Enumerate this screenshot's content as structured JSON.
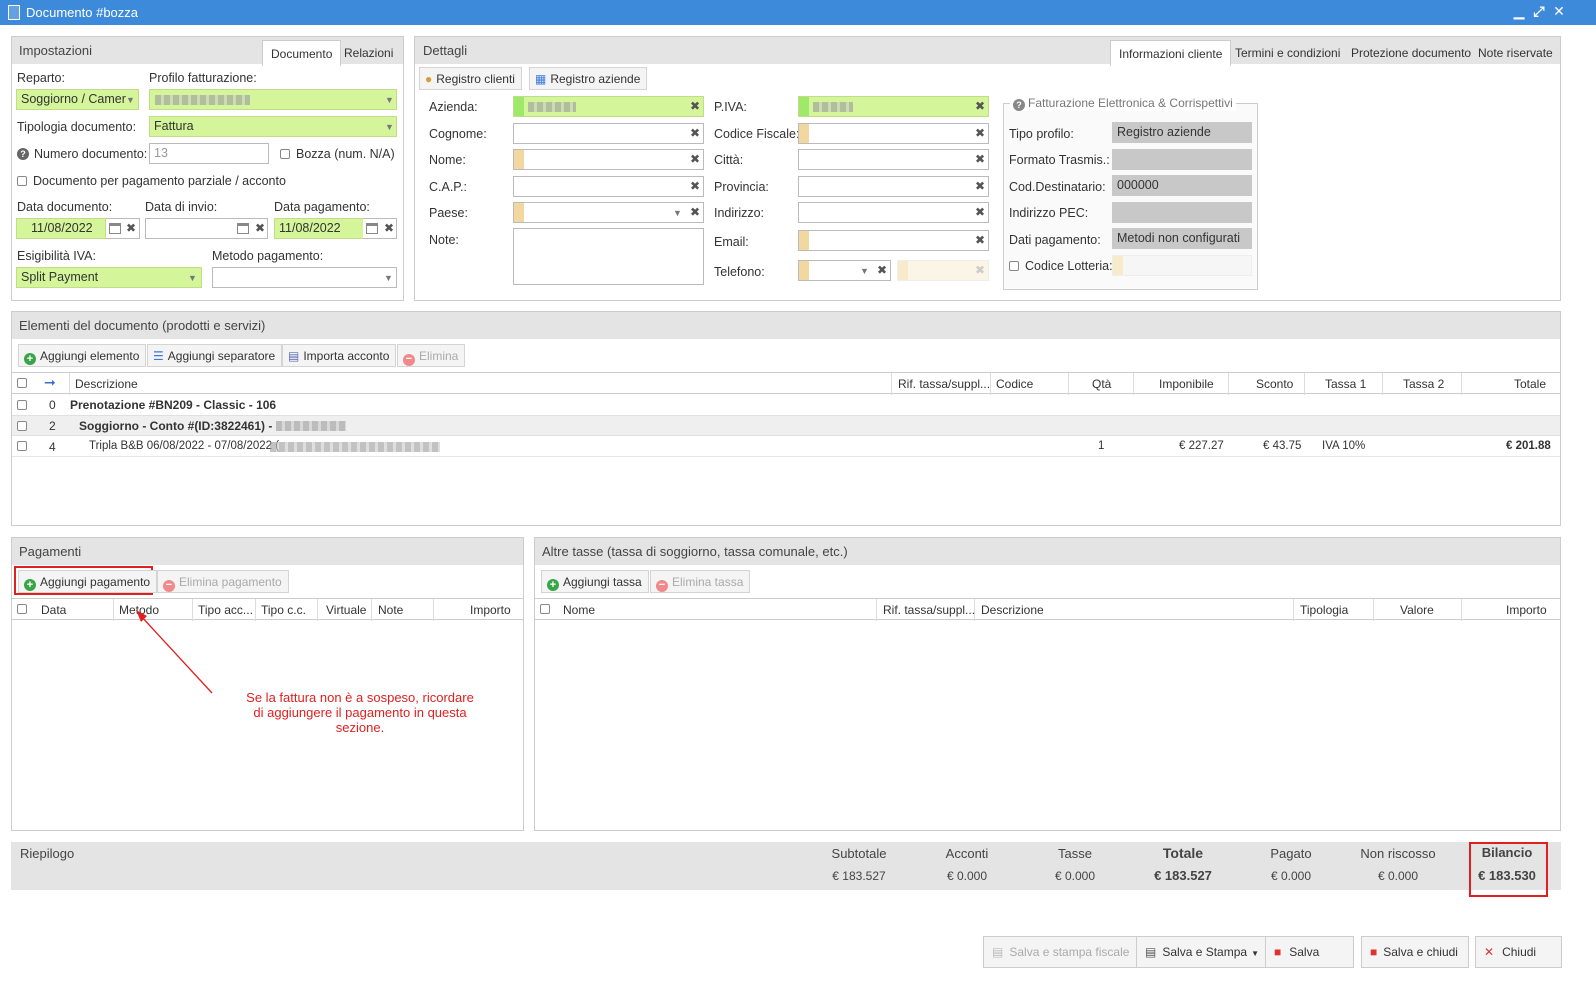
{
  "window": {
    "title": "Documento #bozza"
  },
  "settings": {
    "title": "Impostazioni",
    "tabs": [
      "Documento",
      "Relazioni"
    ],
    "reparto_label": "Reparto:",
    "reparto_value": "Soggiorno / Camer",
    "profilo_label": "Profilo fatturazione:",
    "tipologia_label": "Tipologia documento:",
    "tipologia_value": "Fattura",
    "numero_label": "Numero documento:",
    "numero_placeholder": "13",
    "bozza_label": "Bozza (num. N/A)",
    "parziale_label": "Documento per pagamento parziale / acconto",
    "data_doc_label": "Data documento:",
    "data_doc_value": "11/08/2022",
    "data_invio_label": "Data di invio:",
    "data_pag_label": "Data pagamento:",
    "data_pag_value": "11/08/2022",
    "esigibilita_label": "Esigibilità IVA:",
    "esigibilita_value": "Split Payment",
    "metodo_label": "Metodo pagamento:"
  },
  "details": {
    "title": "Dettagli",
    "tabs": [
      "Informazioni cliente",
      "Termini e condizioni",
      "Protezione documento",
      "Note riservate"
    ],
    "btn_registro_clienti": "Registro clienti",
    "btn_registro_aziende": "Registro aziende",
    "fields_left": [
      "Azienda:",
      "Cognome:",
      "Nome:",
      "C.A.P.:",
      "Paese:",
      "Note:"
    ],
    "fields_mid": [
      "P.IVA:",
      "Codice Fiscale:",
      "Città:",
      "Provincia:",
      "Indirizzo:",
      "Email:",
      "Telefono:"
    ],
    "fe_title": "Fatturazione Elettronica & Corrispettivi",
    "fe_fields": [
      {
        "label": "Tipo profilo:",
        "value": "Registro aziende"
      },
      {
        "label": "Formato Trasmis.:",
        "value": ""
      },
      {
        "label": "Cod.Destinatario:",
        "value": "000000"
      },
      {
        "label": "Indirizzo PEC:",
        "value": ""
      },
      {
        "label": "Dati pagamento:",
        "value": "Metodi non configurati"
      }
    ],
    "lotteria_label": "Codice Lotteria:"
  },
  "elements": {
    "title": "Elementi del documento (prodotti e servizi)",
    "btn_add": "Aggiungi elemento",
    "btn_sep": "Aggiungi separatore",
    "btn_import": "Importa acconto",
    "btn_del": "Elimina",
    "columns": [
      "Descrizione",
      "Rif. tassa/suppl...",
      "Codice",
      "Qtà",
      "Imponibile",
      "Sconto",
      "Tassa 1",
      "Tassa 2",
      "Totale"
    ],
    "rows": [
      {
        "idx": "0",
        "desc": "Prenotazione #BN209 - Classic - 106",
        "qty": "",
        "imp": "",
        "sconto": "",
        "tassa1": "",
        "totale": ""
      },
      {
        "idx": "2",
        "desc": "Soggiorno - Conto #(ID:3822461) -",
        "qty": "",
        "imp": "",
        "sconto": "",
        "tassa1": "",
        "totale": ""
      },
      {
        "idx": "4",
        "desc": "Tripla B&B 06/08/2022 - 07/08/2022 (",
        "qty": "1",
        "imp": "€ 227.27",
        "sconto": "€ 43.75",
        "tassa1": "IVA 10%",
        "totale": "€ 201.88"
      }
    ]
  },
  "payments": {
    "title": "Pagamenti",
    "btn_add": "Aggiungi pagamento",
    "btn_del": "Elimina pagamento",
    "columns": [
      "Data",
      "Metodo",
      "Tipo acc...",
      "Tipo c.c.",
      "Virtuale",
      "Note",
      "Importo"
    ],
    "annotation": [
      "Se la fattura non è a sospeso, ricordare",
      "di aggiungere il pagamento in questa",
      "sezione."
    ]
  },
  "taxes": {
    "title": "Altre tasse (tassa di soggiorno, tassa comunale, etc.)",
    "btn_add": "Aggiungi tassa",
    "btn_del": "Elimina tassa",
    "columns": [
      "Nome",
      "Rif. tassa/suppl...",
      "Descrizione",
      "Tipologia",
      "Valore",
      "Importo"
    ]
  },
  "summary": {
    "title": "Riepilogo",
    "items": [
      {
        "label": "Subtotale",
        "value": "€ 183.527"
      },
      {
        "label": "Acconti",
        "value": "€ 0.000"
      },
      {
        "label": "Tasse",
        "value": "€ 0.000"
      },
      {
        "label": "Totale",
        "value": "€ 183.527"
      },
      {
        "label": "Pagato",
        "value": "€ 0.000"
      },
      {
        "label": "Non riscosso",
        "value": "€ 0.000"
      },
      {
        "label": "Bilancio",
        "value": "€ 183.530"
      }
    ]
  },
  "footer": {
    "btn_fiscale": "Salva e stampa fiscale",
    "btn_stampa": "Salva e Stampa",
    "btn_salva": "Salva",
    "btn_salva_chiudi": "Salva e chiudi",
    "btn_chiudi": "Chiudi"
  },
  "colors": {
    "titlebar": "#3c8ad9",
    "valid_field": "#d5f59a",
    "required_strip": "#f3d7a0",
    "highlight": "#e02020"
  }
}
